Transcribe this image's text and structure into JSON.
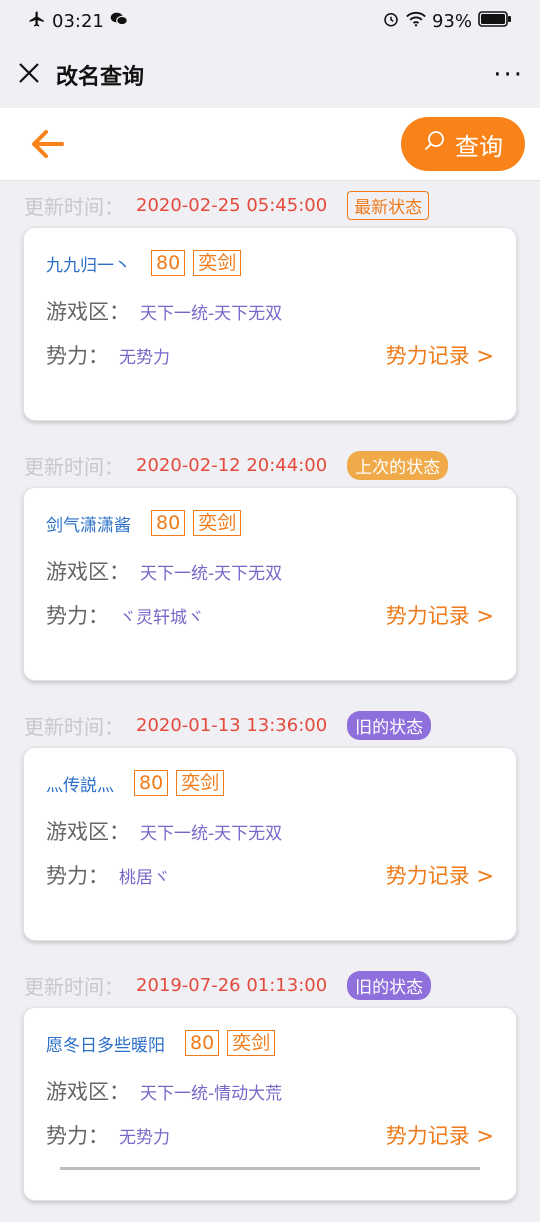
{
  "status_bar": {
    "time": "03:21",
    "battery": "93%"
  },
  "nav": {
    "title": "改名查询",
    "more": "···"
  },
  "toolbar": {
    "search_label": "查询"
  },
  "labels": {
    "update_time": "更新时间：",
    "zone": "游戏区：",
    "force": "势力：",
    "force_record": "势力记录 >"
  },
  "records": [
    {
      "time": "2020-02-25 05:45:00",
      "status": "最新状态",
      "status_type": "newest",
      "name": "九九归一丶",
      "level": "80",
      "sect": "奕剑",
      "zone": "天下一统-天下无双",
      "force": "无势力"
    },
    {
      "time": "2020-02-12 20:44:00",
      "status": "上次的状态",
      "status_type": "last",
      "name": "剑气潇潇酱",
      "level": "80",
      "sect": "奕剑",
      "zone": "天下一统-天下无双",
      "force": "ヾ灵轩城ヾ"
    },
    {
      "time": "2020-01-13 13:36:00",
      "status": "旧的状态",
      "status_type": "old",
      "name": "灬传説灬",
      "level": "80",
      "sect": "奕剑",
      "zone": "天下一统-天下无双",
      "force": "桃居ヾ"
    },
    {
      "time": "2019-07-26 01:13:00",
      "status": "旧的状态",
      "status_type": "old",
      "name": "愿冬日多些暖阳",
      "level": "80",
      "sect": "奕剑",
      "zone": "天下一统-情动大荒",
      "force": "无势力"
    }
  ],
  "colors": {
    "accent": "#fa8319",
    "time": "#e34b3c",
    "name": "#2b6fc9",
    "value": "#7768c9",
    "badge_last": "#f0aa4a",
    "badge_old": "#8f6fdc"
  },
  "icons": [
    "airplane-icon",
    "wechat-icon",
    "alarm-icon",
    "wifi-icon",
    "battery-icon",
    "close-icon",
    "back-arrow-icon",
    "search-icon"
  ]
}
